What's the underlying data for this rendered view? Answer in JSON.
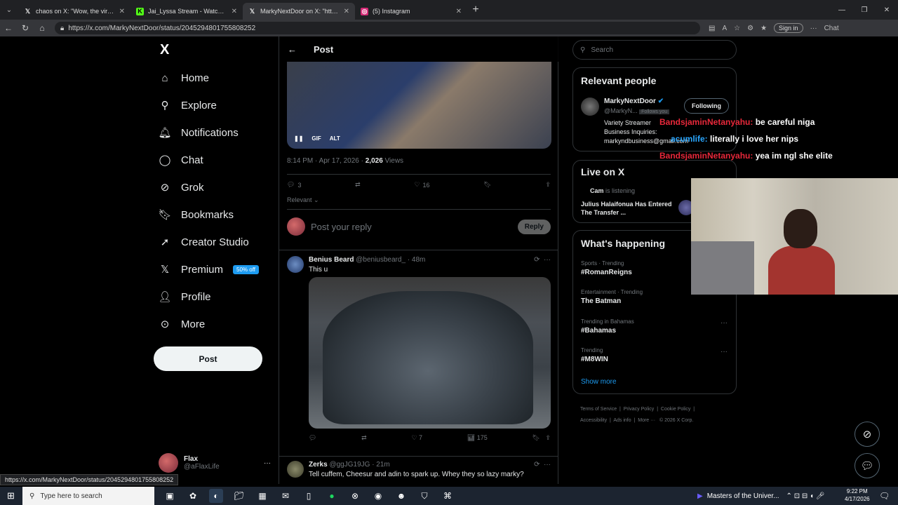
{
  "browser": {
    "tabs": [
      {
        "title": "chaos on X: \"Wow, the viral Armen",
        "icon": "X"
      },
      {
        "title": "Jai_Lyssa Stream - Watch Live on K",
        "icon": "K"
      },
      {
        "title": "MarkyNextDoor on X: \"https://",
        "icon": "X",
        "active": true
      },
      {
        "title": "(5) Instagram",
        "icon": "IG"
      }
    ],
    "url": "https://x.com/MarkyNextDoor/status/2045294801755808252",
    "signin": "Sign in",
    "chat": "Chat"
  },
  "nav": {
    "logo": "X",
    "items": [
      {
        "label": "Home",
        "icon": "home-icon"
      },
      {
        "label": "Explore",
        "icon": "search-icon"
      },
      {
        "label": "Notifications",
        "icon": "bell-icon"
      },
      {
        "label": "Chat",
        "icon": "chat-icon"
      },
      {
        "label": "Grok",
        "icon": "grok-icon"
      },
      {
        "label": "Bookmarks",
        "icon": "bookmark-icon"
      },
      {
        "label": "Creator Studio",
        "icon": "rocket-icon"
      },
      {
        "label": "Premium",
        "icon": "x-icon"
      },
      {
        "label": "Profile",
        "icon": "person-icon"
      },
      {
        "label": "More",
        "icon": "more-circle-icon"
      }
    ],
    "premium_badge": "50% off",
    "post_button": "Post",
    "account": {
      "name": "Flax",
      "handle": "@aFlaxLife"
    }
  },
  "post": {
    "header": "Post",
    "media_controls": [
      "GIF",
      "ALT"
    ],
    "time": "8:14 PM · Apr 17, 2026 · ",
    "views_count": "2,026",
    "views_label": " Views",
    "replies": "3",
    "likes": "16",
    "relevant": "Relevant",
    "reply_placeholder": "Post your reply",
    "reply_button": "Reply"
  },
  "replies": [
    {
      "name": "Benius Beard",
      "handle": "@beniusbeard_ · 48m",
      "text": "This u",
      "likes": "7",
      "views": "175"
    },
    {
      "name": "Zerks",
      "handle": "@ggJG19JG · 21m",
      "text": "Tell cuffem, Cheesur and adin to spark up. Whey they so lazy marky?"
    }
  ],
  "sidebar": {
    "search_placeholder": "Search",
    "relevant_title": "Relevant people",
    "person": {
      "name": "MarkyNextDoor",
      "handle": "@MarkyN...",
      "follows_you": "Follows you",
      "follow_button": "Following",
      "bio1": "Variety Streamer",
      "bio2": "Business Inquiries:",
      "bio3": "markyndbusiness@gmail.com"
    },
    "live_title": "Live on X",
    "live_user": "Cam",
    "live_status": "is listening",
    "live_text": "Julius Halaifonua Has Entered The Transfer ...",
    "happening_title": "What's happening",
    "trends": [
      {
        "category": "Sports · Trending",
        "name": "#RomanReigns"
      },
      {
        "category": "Entertainment · Trending",
        "name": "The Batman"
      },
      {
        "category": "Trending in Bahamas",
        "name": "#Bahamas"
      },
      {
        "category": "Trending",
        "name": "#M8WIN"
      }
    ],
    "show_more": "Show more",
    "footer": [
      "Terms of Service",
      "Privacy Policy",
      "Cookie Policy",
      "Accessibility",
      "Ads info",
      "More ···",
      "© 2026 X Corp."
    ]
  },
  "stream_chat": [
    {
      "user": "BandsjaminNetanyahu:",
      "msg": "be careful niga",
      "color": "#e8283a"
    },
    {
      "user": "acumlife:",
      "msg": "literally i love her nips",
      "color": "#2aa7ff"
    },
    {
      "user": "BandsjaminNetanyahu:",
      "msg": "yea im ngl she elite",
      "color": "#e8283a"
    }
  ],
  "status_url": "https://x.com/MarkyNextDoor/status/2045294801755808252",
  "taskbar": {
    "search": "Type here to search",
    "media": "Masters of the Univer...",
    "time": "9:22 PM",
    "date": "4/17/2026"
  }
}
